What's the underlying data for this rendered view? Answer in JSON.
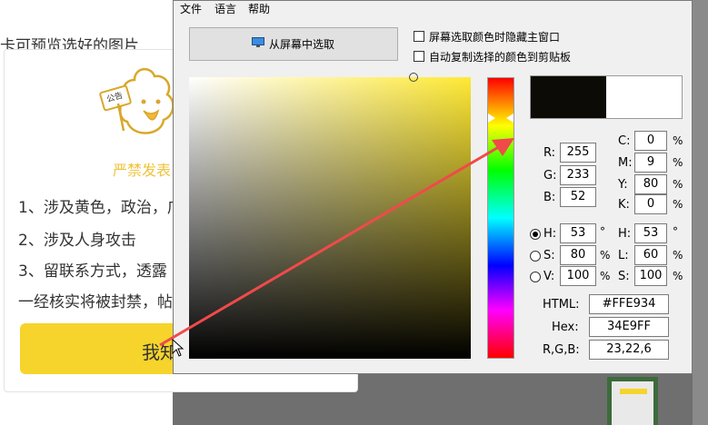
{
  "background_page": {
    "header_text": "卡可预览选好的图片",
    "notice_title": "严禁发表",
    "notice_lines": [
      "1、涉及黄色，政治，广",
      "2、涉及人身攻击",
      "3、留联系方式，透露",
      "一经核实将被封禁，帖"
    ],
    "button_label": "我知",
    "sign_text": "公告"
  },
  "picker": {
    "menu": [
      "文件",
      "语言",
      "帮助"
    ],
    "screen_pick_button": "从屏幕中选取",
    "options": [
      {
        "label": "屏幕选取颜色时隐藏主窗口",
        "checked": false
      },
      {
        "label": "自动复制选择的颜色到剪贴板",
        "checked": false
      }
    ],
    "preview_current_color": "#0d0b06",
    "rgb": [
      {
        "label": "R:",
        "value": "255"
      },
      {
        "label": "G:",
        "value": "233"
      },
      {
        "label": "B:",
        "value": "52"
      }
    ],
    "cmyk": [
      {
        "label": "C:",
        "value": "0",
        "unit": "%"
      },
      {
        "label": "M:",
        "value": "9",
        "unit": "%"
      },
      {
        "label": "Y:",
        "value": "80",
        "unit": "%"
      },
      {
        "label": "K:",
        "value": "0",
        "unit": "%"
      }
    ],
    "hsv": [
      {
        "label": "H:",
        "value": "53",
        "unit": "°",
        "selected": true
      },
      {
        "label": "S:",
        "value": "80",
        "unit": "%",
        "selected": false
      },
      {
        "label": "V:",
        "value": "100",
        "unit": "%",
        "selected": false
      }
    ],
    "hls": [
      {
        "label": "H:",
        "value": "53",
        "unit": "°"
      },
      {
        "label": "L:",
        "value": "60",
        "unit": "%"
      },
      {
        "label": "S:",
        "value": "100",
        "unit": "%"
      }
    ],
    "codes": [
      {
        "label": "HTML:",
        "value": "#FFE934"
      },
      {
        "label": "Hex:",
        "value": "34E9FF"
      },
      {
        "label": "R,G,B:",
        "value": "23,22,6"
      }
    ],
    "annotation_arrow_color": "#f04a4a"
  }
}
